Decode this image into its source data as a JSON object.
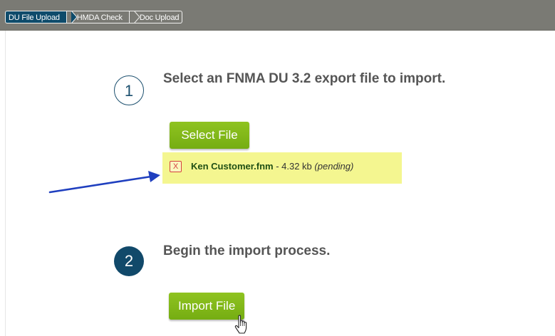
{
  "wizard": {
    "steps": [
      {
        "label": "DU File Upload",
        "active": true
      },
      {
        "label": "HMDA Check",
        "active": false
      },
      {
        "label": "Doc Upload",
        "active": false
      }
    ]
  },
  "step1": {
    "number": "1",
    "title": "Select an FNMA DU 3.2 export file to import.",
    "button_label": "Select File"
  },
  "file": {
    "remove_label": "X",
    "name": "Ken Customer.fnm",
    "separator": " - ",
    "size": "4.32 kb",
    "status": "(pending)"
  },
  "step2": {
    "number": "2",
    "title": "Begin the import process.",
    "button_label": "Import File"
  },
  "colors": {
    "topbar": "#7a7a74",
    "active_crumb": "#0e4b6b",
    "button_green": "#80b81a",
    "highlight": "#f4f690",
    "arrow": "#1f3fbf",
    "remove_red": "#d44040"
  },
  "icons": {
    "arrow": "pointer-arrow-icon",
    "cursor": "hand-cursor-icon"
  }
}
